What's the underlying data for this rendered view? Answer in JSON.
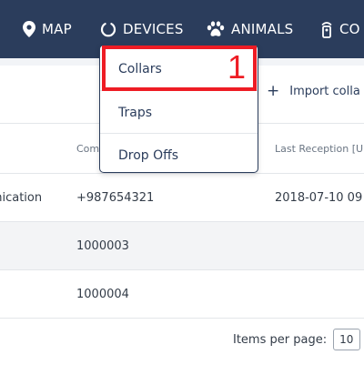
{
  "nav": {
    "items": [
      {
        "label": "MAP",
        "icon": "map-pin-icon"
      },
      {
        "label": "DEVICES",
        "icon": "power-ring-icon"
      },
      {
        "label": "ANIMALS",
        "icon": "paw-icon"
      },
      {
        "label": "CO",
        "icon": "collar-device-icon"
      }
    ]
  },
  "dropdown": {
    "items": [
      "Collars",
      "Traps",
      "Drop Offs"
    ]
  },
  "annotation": {
    "number": "1",
    "color": "#ee1c24"
  },
  "toolbar": {
    "import_label": "Import colla"
  },
  "table": {
    "headers": [
      "Com",
      "Last Reception [U"
    ],
    "rows": [
      [
        "unication",
        "+987654321",
        "2018-07-10 09"
      ],
      [
        "",
        "1000003",
        ""
      ],
      [
        "",
        "1000004",
        ""
      ]
    ]
  },
  "pagination": {
    "label": "Items per page:",
    "value": "10"
  },
  "colors": {
    "navbar": "#2b3d5c",
    "accent_red": "#ee1c24"
  }
}
